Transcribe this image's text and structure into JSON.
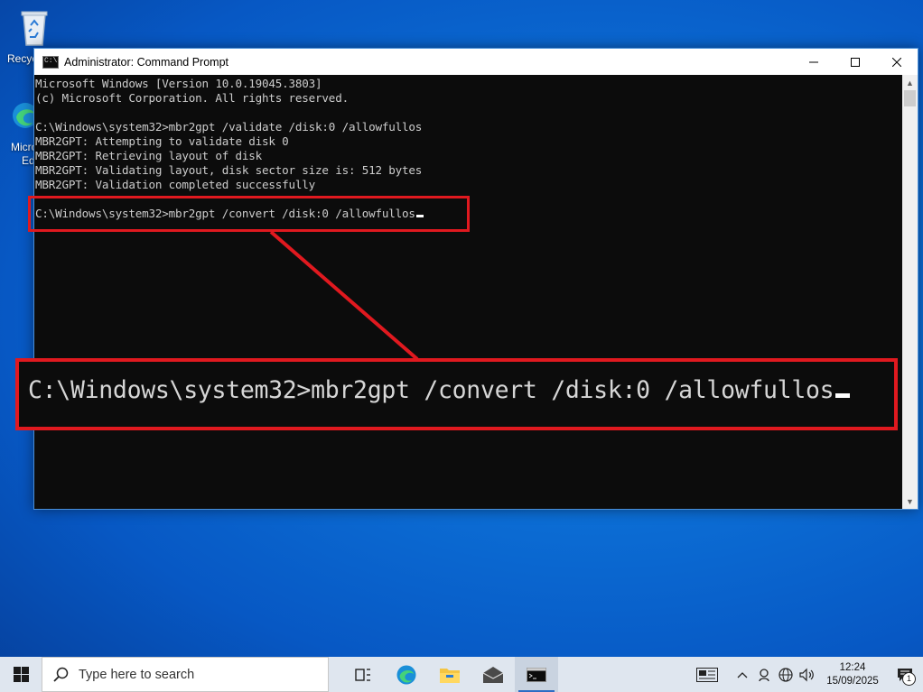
{
  "desktop": {
    "icons": [
      {
        "label": "Recycle Bin",
        "visible_label": "Recyc"
      },
      {
        "label": "Microsoft Edge",
        "visible_label_1": "Micro",
        "visible_label_2": "Ed"
      }
    ]
  },
  "window": {
    "title": "Administrator: Command Prompt",
    "console_lines": [
      "Microsoft Windows [Version 10.0.19045.3803]",
      "(c) Microsoft Corporation. All rights reserved.",
      "",
      "C:\\Windows\\system32>mbr2gpt /validate /disk:0 /allowfullos",
      "MBR2GPT: Attempting to validate disk 0",
      "MBR2GPT: Retrieving layout of disk",
      "MBR2GPT: Validating layout, disk sector size is: 512 bytes",
      "MBR2GPT: Validation completed successfully",
      "",
      "C:\\Windows\\system32>mbr2gpt /convert /disk:0 /allowfullos"
    ]
  },
  "annotation": {
    "zoomed_command": "C:\\Windows\\system32>mbr2gpt /convert /disk:0 /allowfullos",
    "color": "#e0191f"
  },
  "taskbar": {
    "search_placeholder": "Type here to search",
    "apps": [
      "task-view",
      "edge",
      "file-explorer",
      "mail",
      "command-prompt"
    ],
    "active_app": "command-prompt",
    "clock_time": "12:24",
    "clock_date": "15/09/2025",
    "notification_count": "1"
  }
}
